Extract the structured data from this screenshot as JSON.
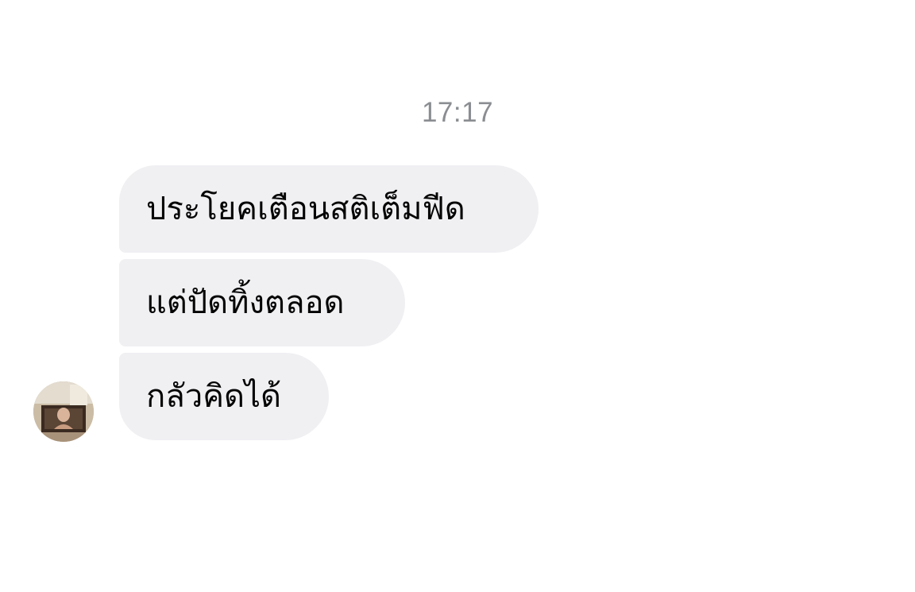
{
  "conversation": {
    "timestamp": "17:17",
    "messages": [
      {
        "text": "ประโยคเตือนสติเต็มฟีด"
      },
      {
        "text": "แต่ปัดทิ้งตลอด"
      },
      {
        "text": "กลัวคิดได้"
      }
    ],
    "sender": {
      "avatar_icon": "profile-photo-avatar"
    }
  },
  "colors": {
    "bubble_bg": "#f0f0f3",
    "bubble_text": "#050505",
    "timestamp_text": "#8a8d91",
    "background": "#ffffff"
  }
}
